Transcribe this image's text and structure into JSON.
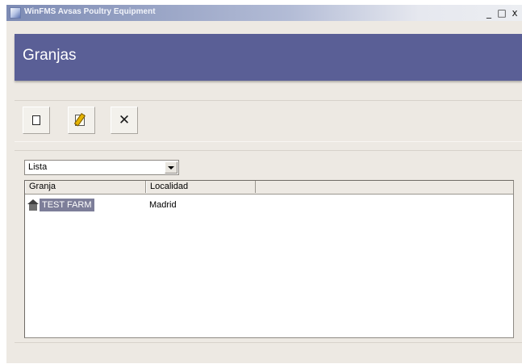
{
  "window": {
    "title": "WinFMS Avsas Poultry Equipment",
    "controls": {
      "minimize": "_",
      "maximize": "□",
      "close": "x"
    }
  },
  "header": {
    "title": "Granjas"
  },
  "toolbar": {
    "buttons": [
      {
        "icon": "new-document-icon"
      },
      {
        "icon": "edit-document-icon",
        "glyph": ""
      },
      {
        "icon": "delete-icon",
        "glyph": "✕"
      }
    ]
  },
  "view_select": {
    "value": "Lista"
  },
  "list": {
    "columns": [
      "Granja",
      "Localidad"
    ],
    "rows": [
      {
        "icon": "farm-icon",
        "granja": "TEST FARM",
        "localidad": "Madrid",
        "selected": true
      }
    ]
  },
  "colors": {
    "header_band": "#5a5f96",
    "selection": "#7d7e99",
    "window_bg": "#ede9e3"
  }
}
